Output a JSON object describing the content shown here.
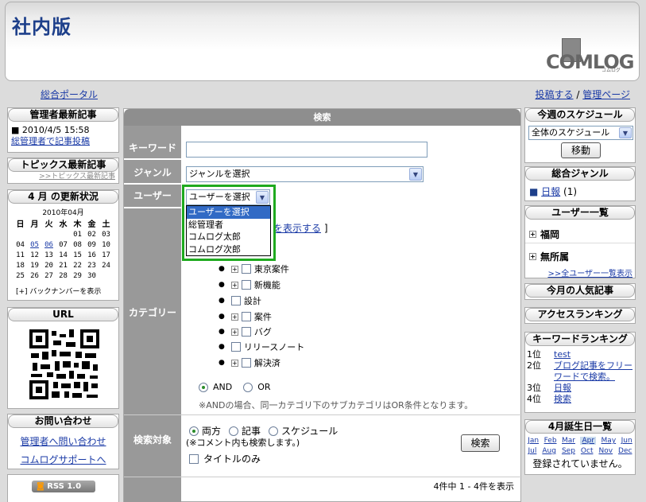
{
  "header": {
    "site_title": "社内版",
    "logo_text": "COMLOG",
    "logo_sub": "コムログ"
  },
  "nav": {
    "portal": "総合ポータル",
    "post": "投稿する",
    "separator": "/",
    "admin": "管理ページ"
  },
  "left": {
    "admin_articles": {
      "title": "管理者最新記事",
      "date": "■ 2010/4/5 15:58",
      "link": "総管理者で記事投稿"
    },
    "topics": {
      "title": "トピックス最新記事",
      "link": ">>トピックス最新記事"
    },
    "update_status": {
      "title": "4 月 の更新状況",
      "month": "2010年04月",
      "weekdays": [
        "日",
        "月",
        "火",
        "水",
        "木",
        "金",
        "土"
      ],
      "weeks": [
        [
          "",
          "",
          "",
          "",
          "01",
          "02",
          "03"
        ],
        [
          "04",
          "05",
          "06",
          "07",
          "08",
          "09",
          "10"
        ],
        [
          "11",
          "12",
          "13",
          "14",
          "15",
          "16",
          "17"
        ],
        [
          "18",
          "19",
          "20",
          "21",
          "22",
          "23",
          "24"
        ],
        [
          "25",
          "26",
          "27",
          "28",
          "29",
          "30",
          ""
        ]
      ],
      "backnumber": "[+] バックナンバーを表示"
    },
    "url": {
      "title": "URL"
    },
    "contact": {
      "title": "お問い合わせ",
      "link1": "管理者へ問い合わせ",
      "link2": "コムログサポートへ"
    },
    "rss": {
      "label": "RSS 1.0"
    }
  },
  "search": {
    "title": "検索",
    "keyword_label": "キーワード",
    "keyword_value": "",
    "genre_label": "ジャンル",
    "genre_value": "ジャンルを選択",
    "user_label": "ユーザー",
    "user_value": "ユーザーを選択",
    "user_options": [
      "ユーザーを選択",
      "総管理者",
      "コムログ太郎",
      "コムログ次郎"
    ],
    "show_link": "を表示する",
    "show_bracket": "]",
    "category_label": "カテゴリー",
    "categories": [
      {
        "label": "東京案件",
        "expandable": true
      },
      {
        "label": "新機能",
        "expandable": true
      },
      {
        "label": "設計",
        "expandable": false
      },
      {
        "label": "案件",
        "expandable": true
      },
      {
        "label": "バグ",
        "expandable": true
      },
      {
        "label": "リリースノート",
        "expandable": false
      },
      {
        "label": "解決済",
        "expandable": true
      }
    ],
    "and_label": "AND",
    "or_label": "OR",
    "and_note": "※ANDの場合、同一カテゴリ下のサブカテゴリはOR条件となります。",
    "target_label": "検索対象",
    "target_both": "両方",
    "target_article": "記事",
    "target_schedule": "スケジュール",
    "target_note": "(※コメント内も検索します。)",
    "title_only": "タイトルのみ",
    "search_button": "検索",
    "result_count": "4件中 1 - 4件を表示"
  },
  "right": {
    "schedule": {
      "title": "今週のスケジュール",
      "select": "全体のスケジュール",
      "move": "移動"
    },
    "genre": {
      "title": "総合ジャンル",
      "item": "日報",
      "count": "(1)"
    },
    "users": {
      "title": "ユーザー一覧",
      "group1": "福岡",
      "group2": "無所属",
      "all": ">>全ユーザー一覧表示"
    },
    "popular": {
      "title": "今月の人気記事"
    },
    "access": {
      "title": "アクセスランキング"
    },
    "keyword_rank": {
      "title": "キーワードランキング",
      "items": [
        {
          "rank": "1位",
          "word": "test"
        },
        {
          "rank": "2位",
          "word": "ブログ記事をフリーワードで検索。"
        },
        {
          "rank": "3位",
          "word": "日報"
        },
        {
          "rank": "4位",
          "word": "検索"
        }
      ]
    },
    "birthday": {
      "title": "4月誕生日一覧",
      "months1": [
        "Jan",
        "Feb",
        "Mar",
        "Apr",
        "May",
        "Jun"
      ],
      "months2": [
        "Jul",
        "Aug",
        "Sep",
        "Oct",
        "Nov",
        "Dec"
      ],
      "none": "登録されていません。"
    }
  },
  "colors": {
    "accent_green": "#1faa1f",
    "link": "#1a3aa6",
    "header_title": "#1d3f8a",
    "label_bg": "#999999"
  }
}
